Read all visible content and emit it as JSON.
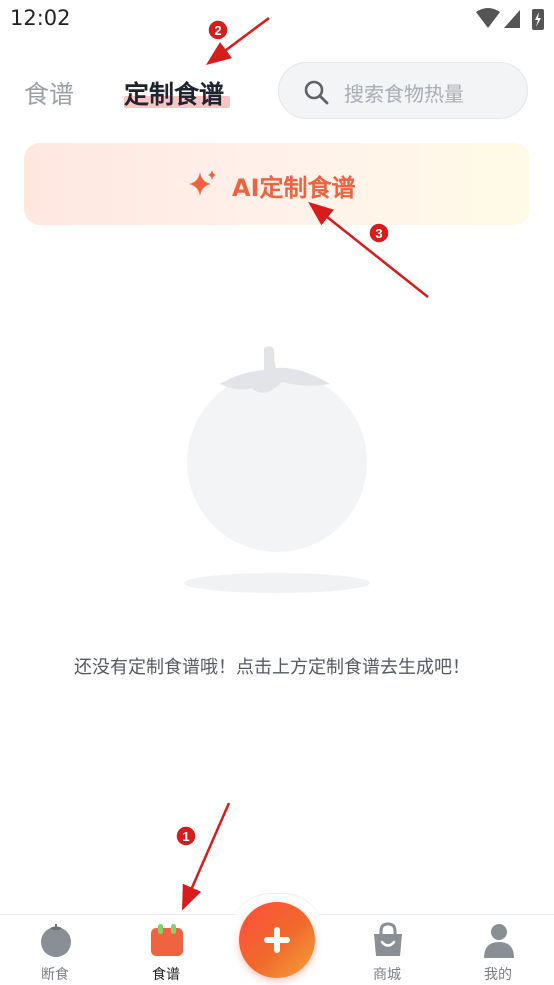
{
  "status_bar": {
    "time": "12:02"
  },
  "header": {
    "tabs": [
      "食谱",
      "定制食谱"
    ],
    "active_tab": "定制食谱",
    "search_placeholder": "搜索食物热量"
  },
  "ai_button": {
    "label": "AI定制食谱"
  },
  "empty_state": {
    "message": "还没有定制食谱哦！点击上方定制食谱去生成吧！"
  },
  "annotations": [
    "1",
    "2",
    "3"
  ],
  "bottom_nav": {
    "items": [
      {
        "label": "断食",
        "icon": "tomato-icon",
        "active": false
      },
      {
        "label": "食谱",
        "icon": "recipe-calendar-icon",
        "active": true
      },
      {
        "label": "",
        "icon": "plus-icon",
        "active": false
      },
      {
        "label": "商城",
        "icon": "shopping-bag-icon",
        "active": false
      },
      {
        "label": "我的",
        "icon": "person-icon",
        "active": false
      }
    ]
  },
  "colors": {
    "accent": "#f06341",
    "active_tab_underline": "#f9c4c4",
    "annotation_red": "#d81b1b"
  }
}
